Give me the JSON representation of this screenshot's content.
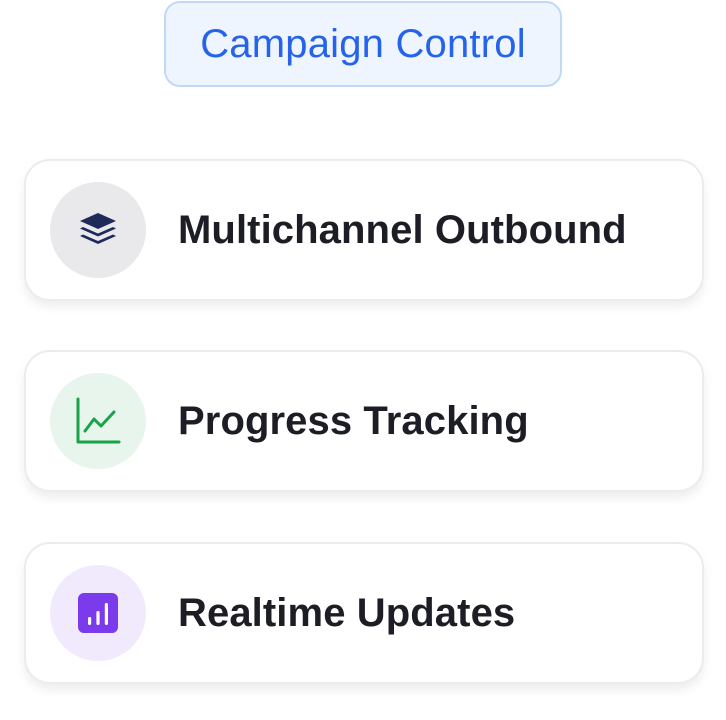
{
  "header": {
    "title": "Campaign Control"
  },
  "features": [
    {
      "label": "Multichannel Outbound",
      "icon": "layers-icon",
      "icon_color": "#1e2a5a",
      "circle_color": "#e9e9ec"
    },
    {
      "label": "Progress Tracking",
      "icon": "line-chart-icon",
      "icon_color": "#16a34a",
      "circle_color": "#e8f5ec"
    },
    {
      "label": "Realtime Updates",
      "icon": "bar-chart-icon",
      "icon_color": "#7c3aed",
      "circle_color": "#f1eafd"
    }
  ],
  "colors": {
    "accent": "#2563eb",
    "pill_background": "#eef5ff",
    "pill_border": "#bfd9f8",
    "text": "#1d1d25"
  }
}
